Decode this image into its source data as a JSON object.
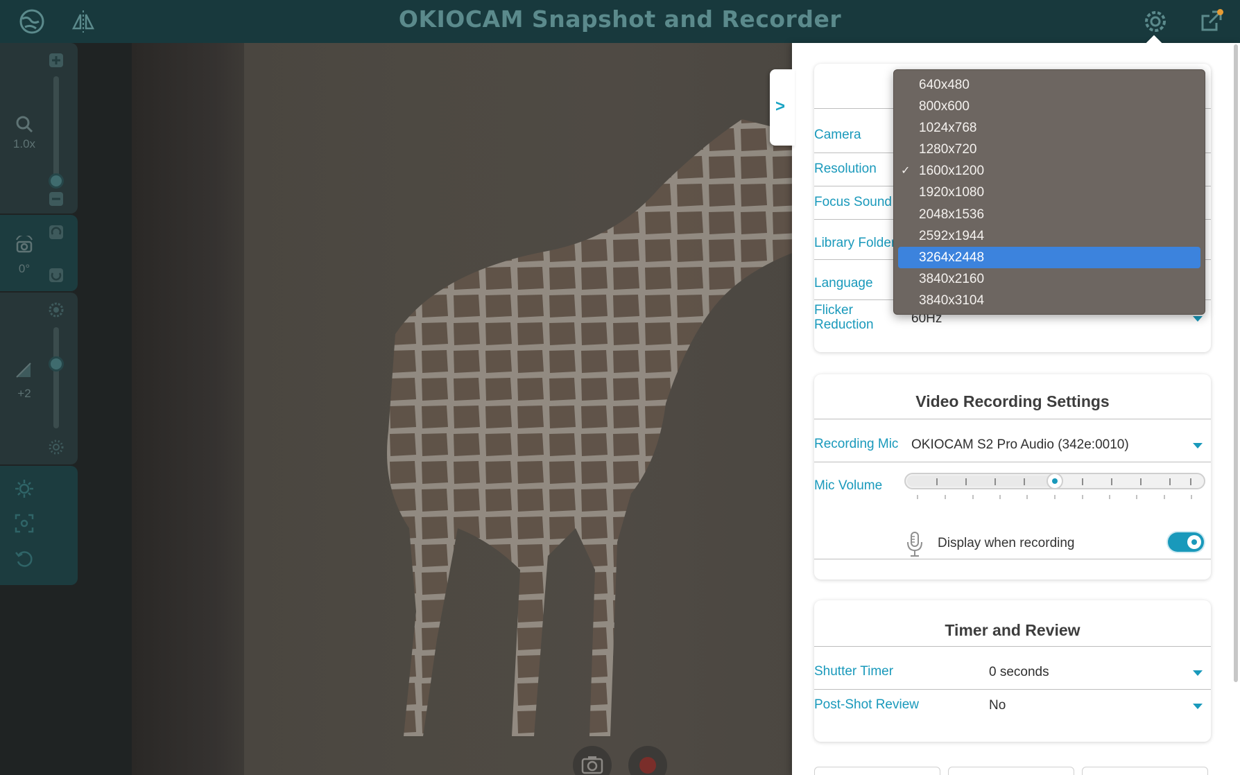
{
  "app": {
    "title": "OKIOCAM Snapshot and Recorder"
  },
  "left_toolbar": {
    "zoom_label": "1.0x",
    "rotation_label": "0°",
    "brightness_label": "+2"
  },
  "settings": {
    "general": {
      "rows": [
        {
          "label": "Camera"
        },
        {
          "label": "Resolution"
        },
        {
          "label": "Focus Sound"
        },
        {
          "label": "Library Folder"
        },
        {
          "label": "Language"
        },
        {
          "label": "Flicker Reduction",
          "value": "60Hz"
        }
      ]
    },
    "video": {
      "title": "Video Recording Settings",
      "recording_mic_label": "Recording Mic",
      "recording_mic_value": "OKIOCAM S2 Pro Audio (342e:0010)",
      "mic_volume_label": "Mic Volume",
      "mic_volume_level": 0.5,
      "display_when_recording_label": "Display when recording",
      "display_when_recording_on": true
    },
    "timer": {
      "title": "Timer and Review",
      "shutter_timer_label": "Shutter Timer",
      "shutter_timer_value": "0 seconds",
      "post_shot_review_label": "Post-Shot Review",
      "post_shot_review_value": "No"
    }
  },
  "resolution_dropdown": {
    "checked": "1600x1200",
    "highlighted": "3264x2448",
    "options": [
      "640x480",
      "800x600",
      "1024x768",
      "1280x720",
      "1600x1200",
      "1920x1080",
      "2048x1536",
      "2592x1944",
      "3264x2448",
      "3840x2160",
      "3840x3104"
    ]
  },
  "colors": {
    "accent": "#1999bb",
    "titlebar": "#18393d",
    "selection": "#3c83dd",
    "notification_dot": "#e79b33"
  }
}
